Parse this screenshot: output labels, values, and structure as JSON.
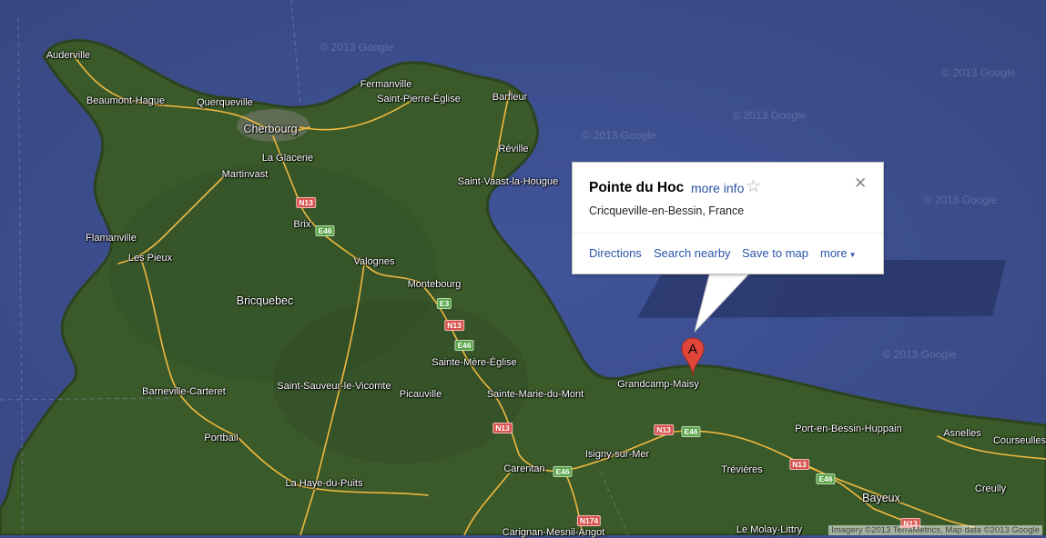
{
  "colors": {
    "sea": "#3c4f8c",
    "land": "#3b5a2b",
    "road": "#f0b940",
    "popup_link": "#2a53a8",
    "marker": "#e0453a"
  },
  "popup": {
    "title": "Pointe du Hoc",
    "more_info": "more info",
    "star_icon": "☆",
    "close_icon": "✕",
    "address": "Cricqueville-en-Bessin, France",
    "actions": {
      "directions": "Directions",
      "search_nearby": "Search nearby",
      "save_to_map": "Save to map",
      "more": "more"
    }
  },
  "marker": {
    "label": "A"
  },
  "places": {
    "auderville": "Auderville",
    "beaumont_hague": "Beaumont-Hague",
    "querqueville": "Querqueville",
    "cherbourg": "Cherbourg",
    "la_glacerie": "La Glacerie",
    "martinvast": "Martinvast",
    "fermanville": "Fermanville",
    "saint_pierre_eglise": "Saint-Pierre-Église",
    "barfleur": "Barfleur",
    "reville": "Réville",
    "saint_vaast": "Saint-Vaast-la-Hougue",
    "brix": "Brix",
    "flamanville": "Flamanville",
    "les_pieux": "Les Pieux",
    "valognes": "Valognes",
    "montebourg": "Montebourg",
    "bricquebec": "Bricquebec",
    "sainte_mere_eglise": "Sainte-Mère-Église",
    "saint_sauveur": "Saint-Sauveur-le-Vicomte",
    "picauville": "Picauville",
    "sainte_marie_du_mont": "Sainte-Marie-du-Mont",
    "barneville_carteret": "Barneville-Carteret",
    "grandcamp_maisy": "Grandcamp-Maisy",
    "port_en_bessin": "Port-en-Bessin-Huppain",
    "asnelles": "Asnelles",
    "courseulles": "Courseulles",
    "portbail": "Portbail",
    "isigny": "Isigny-sur-Mer",
    "carentan": "Carentan",
    "trevieres": "Trévières",
    "creully": "Creully",
    "bayeux": "Bayeux",
    "la_haye_du_puits": "La Haye-du-Puits",
    "le_molay_littry": "Le Molay-Littry",
    "carignan_mesnil_angot": "Carignan-Mesnil-Angot"
  },
  "roads": {
    "n13": "N13",
    "e46": "E46",
    "e3": "E3",
    "n174": "N174"
  },
  "watermark": "© 2013 Google",
  "attribution": "Imagery ©2013 TerraMetrics, Map data ©2013 Google"
}
